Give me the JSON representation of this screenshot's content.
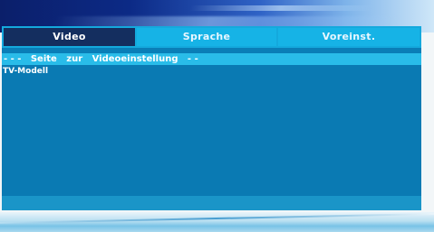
{
  "tabs": [
    {
      "label": "Video",
      "active": true
    },
    {
      "label": "Sprache",
      "active": false
    },
    {
      "label": "Voreinst.",
      "active": false
    }
  ],
  "section": {
    "header": "- - -   Seite   zur   Videoeinstellung   - -"
  },
  "menu": {
    "items": [
      {
        "label": "TV-Modell"
      }
    ]
  },
  "colors": {
    "active_tab_bg": "#142e5f",
    "tab_bar_bg": "#14a9dd",
    "section_header_bg": "#29bce9",
    "content_bg": "#0a7ab3"
  }
}
